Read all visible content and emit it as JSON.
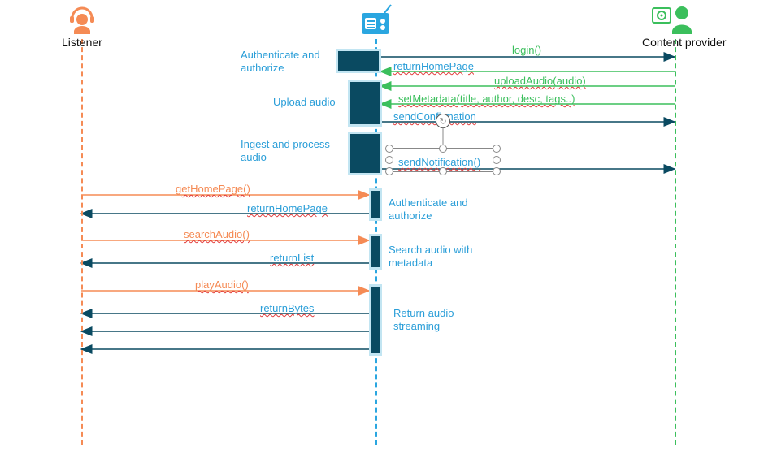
{
  "actors": {
    "listener": {
      "label": "Listener",
      "color": "#f58b55"
    },
    "system": {
      "label": "",
      "color": "#2aa6e0"
    },
    "provider": {
      "label": "Content provider",
      "color": "#3bbf5c"
    }
  },
  "notes": {
    "auth1": "Authenticate and\nauthorize",
    "upload": "Upload audio",
    "ingest": "Ingest and process\naudio",
    "auth2": "Authenticate and\nauthorize",
    "search": "Search audio with\nmetadata",
    "stream": "Return audio\nstreaming"
  },
  "messages": {
    "login": "login()",
    "returnHomePage1": "returnHomePage",
    "uploadAudio": "uploadAudio(audio)",
    "setMetadata": "setMetadata(title, author, desc, tags..)",
    "sendConfirmation": "sendConfirmation",
    "sendNotification": "sendNotification()",
    "getHomePage": "getHomePage()",
    "returnHomePage2": "returnHomePage",
    "searchAudio": "searchAudio()",
    "returnList": "returnList",
    "playAudio": "playAudio()",
    "returnBytes": "returnBytes"
  },
  "chart_data": {
    "type": "diagram",
    "subtype": "uml-sequence",
    "participants": [
      "Listener",
      "System",
      "Content provider"
    ],
    "interactions": [
      {
        "from": "Content provider",
        "to": "System",
        "label": "login()",
        "direction": "request"
      },
      {
        "from": "System",
        "to": "Content provider",
        "label": "returnHomePage",
        "direction": "response",
        "note_left": "Authenticate and authorize"
      },
      {
        "from": "Content provider",
        "to": "System",
        "label": "uploadAudio(audio)",
        "direction": "request"
      },
      {
        "from": "Content provider",
        "to": "System",
        "label": "setMetadata(title, author, desc, tags..)",
        "direction": "request",
        "note_left": "Upload audio"
      },
      {
        "from": "System",
        "to": "Content provider",
        "label": "sendConfirmation",
        "direction": "response"
      },
      {
        "from": "System",
        "to": "Content provider",
        "label": "sendNotification()",
        "direction": "response",
        "note_left": "Ingest and process audio"
      },
      {
        "from": "Listener",
        "to": "System",
        "label": "getHomePage()",
        "direction": "request"
      },
      {
        "from": "System",
        "to": "Listener",
        "label": "returnHomePage",
        "direction": "response",
        "note_right": "Authenticate and authorize"
      },
      {
        "from": "Listener",
        "to": "System",
        "label": "searchAudio()",
        "direction": "request"
      },
      {
        "from": "System",
        "to": "Listener",
        "label": "returnList",
        "direction": "response",
        "note_right": "Search audio with metadata"
      },
      {
        "from": "Listener",
        "to": "System",
        "label": "playAudio()",
        "direction": "request"
      },
      {
        "from": "System",
        "to": "Listener",
        "label": "returnBytes",
        "direction": "response",
        "note_right": "Return audio streaming"
      }
    ]
  }
}
